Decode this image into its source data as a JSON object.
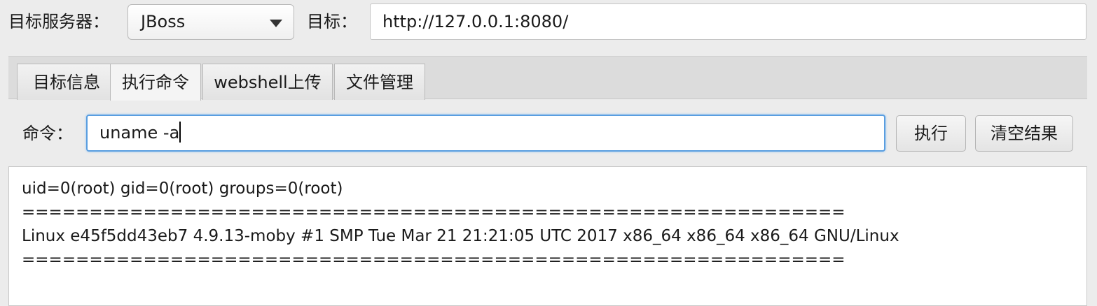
{
  "toolbar": {
    "server_label": "目标服务器：",
    "server_value": "JBoss",
    "target_label": "目标：",
    "target_value": "http://127.0.0.1:8080/"
  },
  "tabs": [
    {
      "label": "目标信息",
      "active": false
    },
    {
      "label": "执行命令",
      "active": true
    },
    {
      "label": "webshell上传",
      "active": false
    },
    {
      "label": "文件管理",
      "active": false
    }
  ],
  "command": {
    "label": "命令：",
    "value": "uname -a",
    "execute_label": "执行",
    "clear_label": "清空结果"
  },
  "output": {
    "lines": [
      "uid=0(root) gid=0(root) groups=0(root)",
      "=============================================================",
      "Linux e45f5dd43eb7 4.9.13-moby #1 SMP Tue Mar 21 21:21:05 UTC 2017 x86_64 x86_64 x86_64 GNU/Linux",
      "============================================================="
    ]
  },
  "colors": {
    "focus_border": "#5a9ee0",
    "background": "#ececec"
  }
}
